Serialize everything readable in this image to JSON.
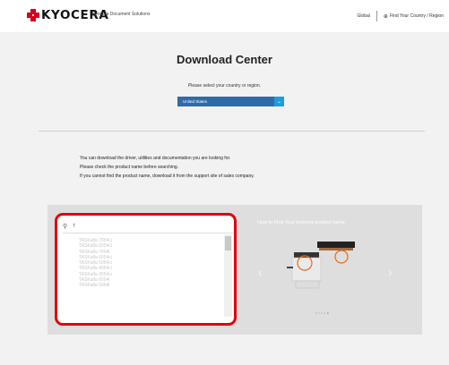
{
  "header": {
    "brand": "KYOCERA",
    "subbrand": "Kyocera Document Solutions",
    "global_link": "Global",
    "region_link": "Find Your Country / Region"
  },
  "main": {
    "title": "Download Center",
    "country_prompt": "Please select your country or region.",
    "country_selected": "United States",
    "info_lines": [
      "You can download the driver, utilities and documentation you are looking for.",
      "Please check the product name before searching.",
      "If you cannot find the product name, download it from the support site of sales company."
    ]
  },
  "search": {
    "query": "T",
    "results": [
      "TASKalfa 7054ci",
      "TASKalfa 6054ci",
      "TASKalfa 7004i",
      "TASKalfa 6004ci",
      "TASKalfa 5054ci",
      "TASKalfa 4054ci",
      "TASKalfa 3554ci",
      "TASKalfa 6004i",
      "TASKalfa 5004i"
    ]
  },
  "howto": {
    "title": "How to Find Your kyocera product name",
    "pager": "• • • • ●"
  },
  "colors": {
    "brand_red": "#d6001c",
    "highlight_red": "#e0000f",
    "select_blue": "#2f6ba8",
    "select_button_blue": "#1f9be0"
  }
}
